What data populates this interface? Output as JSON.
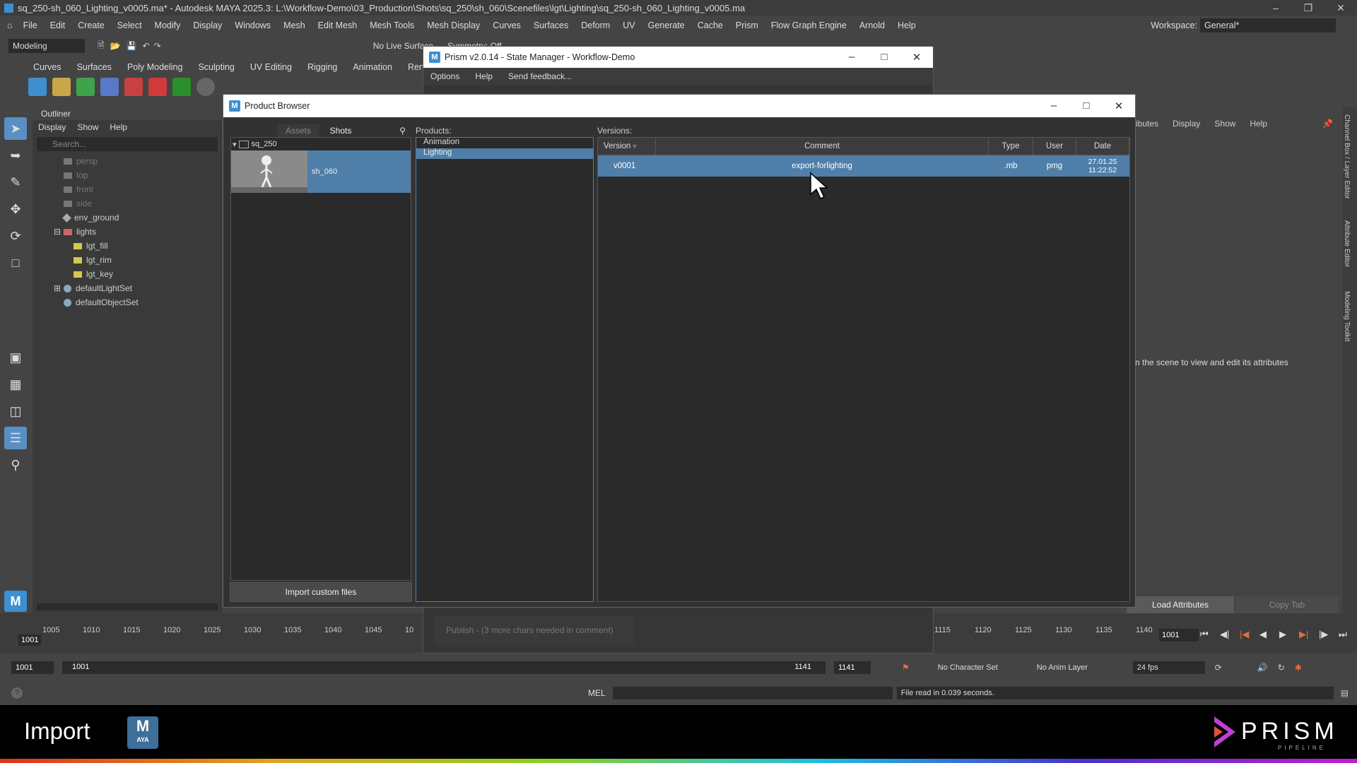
{
  "window": {
    "title": "sq_250-sh_060_Lighting_v0005.ma* - Autodesk MAYA 2025.3: L:\\Workflow-Demo\\03_Production\\Shots\\sq_250\\sh_060\\Scenefiles\\lgt\\Lighting\\sq_250-sh_060_Lighting_v0005.ma"
  },
  "menubar": {
    "items": [
      "File",
      "Edit",
      "Create",
      "Select",
      "Modify",
      "Display",
      "Windows",
      "Mesh",
      "Edit Mesh",
      "Mesh Tools",
      "Mesh Display",
      "Curves",
      "Surfaces",
      "Deform",
      "UV",
      "Generate",
      "Cache",
      "Prism",
      "Flow Graph Engine",
      "Arnold",
      "Help"
    ],
    "workspace_label": "Workspace:",
    "workspace_value": "General*"
  },
  "toolbar": {
    "mode": "Modeling",
    "live_surface": "No Live Surface",
    "symmetry": "Symmetry: Off"
  },
  "shelf": {
    "tabs": [
      "Curves",
      "Surfaces",
      "Poly Modeling",
      "Sculpting",
      "UV Editing",
      "Rigging",
      "Animation",
      "Rende"
    ]
  },
  "outliner": {
    "title": "Outliner",
    "menu": [
      "Display",
      "Show",
      "Help"
    ],
    "search_placeholder": "Search...",
    "items": [
      {
        "label": "persp",
        "dim": true,
        "indent": 0
      },
      {
        "label": "top",
        "dim": true,
        "indent": 0
      },
      {
        "label": "front",
        "dim": true,
        "indent": 0
      },
      {
        "label": "side",
        "dim": true,
        "indent": 0
      },
      {
        "label": "env_ground",
        "dim": false,
        "indent": 0
      },
      {
        "label": "lights",
        "dim": false,
        "indent": 0
      },
      {
        "label": "lgt_fill",
        "dim": false,
        "indent": 1
      },
      {
        "label": "lgt_rim",
        "dim": false,
        "indent": 1
      },
      {
        "label": "lgt_key",
        "dim": false,
        "indent": 1
      },
      {
        "label": "defaultLightSet",
        "dim": false,
        "indent": 0
      },
      {
        "label": "defaultObjectSet",
        "dim": false,
        "indent": 0
      }
    ]
  },
  "state_manager": {
    "title": "Prism v2.0.14 - State Manager - Workflow-Demo",
    "menu": [
      "Options",
      "Help",
      "Send feedback..."
    ],
    "publish_text": "Publish - (3 more chars needed in comment)"
  },
  "product_browser": {
    "title": "Product Browser",
    "tabs": [
      "Assets",
      "Shots"
    ],
    "sequence": "sq_250",
    "shot": "sh_060",
    "import_button": "Import custom files",
    "products_label": "Products:",
    "products": [
      "Animation",
      "Lighting"
    ],
    "selected_product": "Lighting",
    "versions_label": "Versions:",
    "columns": [
      "Version",
      "Comment",
      "Type",
      "User",
      "Date"
    ],
    "rows": [
      {
        "version": "v0001",
        "comment": "export-forlighting",
        "type": ".mb",
        "user": "pmg",
        "date": "27.01.25 11:22:52"
      }
    ]
  },
  "right_panel": {
    "menu": [
      "ibutes",
      "Display",
      "Show",
      "Help"
    ],
    "hint": "n the scene to view and edit its attributes",
    "load_attributes": "Load Attributes",
    "copy_tab": "Copy Tab",
    "side_tabs": [
      "Channel Box / Layer Editor",
      "Attribute Editor",
      "Modeling Toolkit"
    ]
  },
  "timeline": {
    "ticks_left": [
      "1005",
      "1010",
      "1015",
      "1020",
      "1025",
      "1030",
      "1035",
      "1040",
      "1045",
      "10"
    ],
    "ticks_right": [
      "1115",
      "1120",
      "1125",
      "1130",
      "1135",
      "1140"
    ],
    "current_frame": "1001",
    "frame_field": "1001"
  },
  "range": {
    "start": "1001",
    "inner_start": "1001",
    "inner_end": "1141",
    "end": "1141",
    "character_set": "No Character Set",
    "anim_layer": "No Anim Layer",
    "fps": "24 fps"
  },
  "cmdline": {
    "lang": "MEL",
    "status": "File read in  0.039 seconds."
  },
  "footer": {
    "caption": "Import",
    "brand": "PRISM",
    "brand_sub": "PIPELINE",
    "maya_badge": "AYA"
  },
  "colors": {
    "selection": "#4f7ea8",
    "accent": "#3d8fd1"
  }
}
